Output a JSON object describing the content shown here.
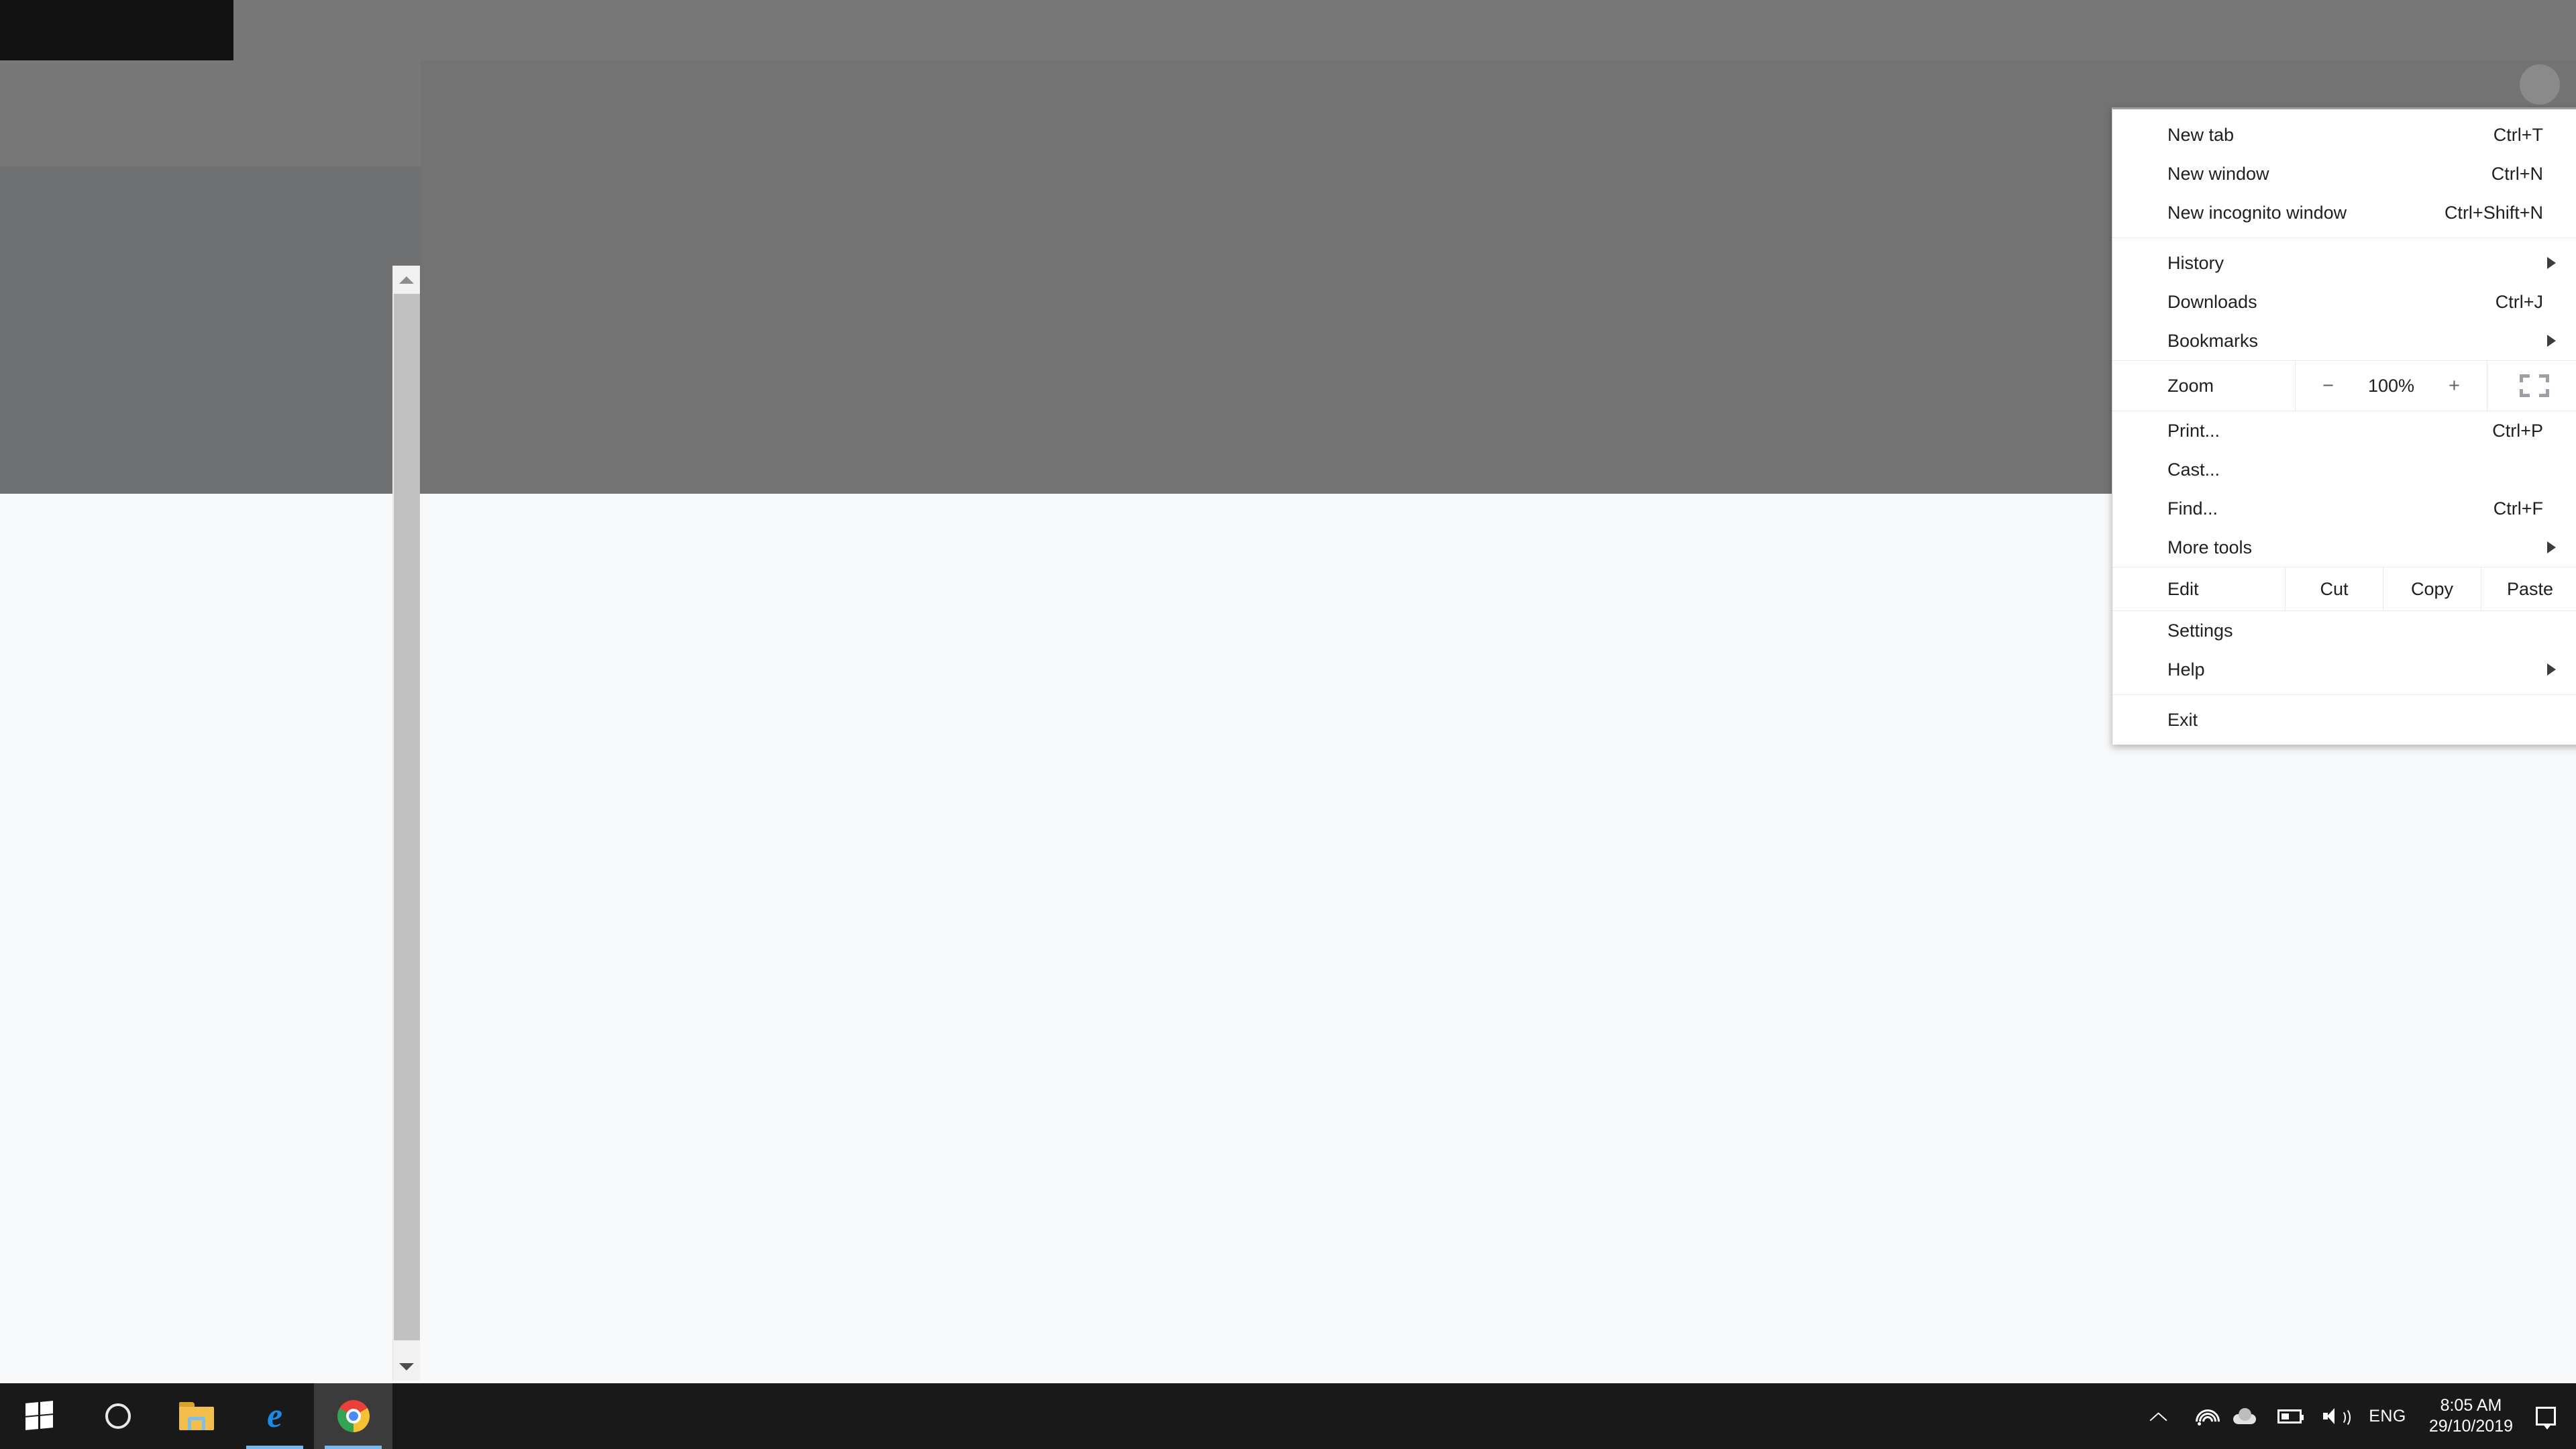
{
  "chrome_menu": {
    "groups": [
      {
        "items": [
          {
            "label": "New tab",
            "shortcut": "Ctrl+T",
            "has_submenu": false
          },
          {
            "label": "New window",
            "shortcut": "Ctrl+N",
            "has_submenu": false
          },
          {
            "label": "New incognito window",
            "shortcut": "Ctrl+Shift+N",
            "has_submenu": false
          }
        ]
      },
      {
        "items": [
          {
            "label": "History",
            "shortcut": "",
            "has_submenu": true
          },
          {
            "label": "Downloads",
            "shortcut": "Ctrl+J",
            "has_submenu": false
          },
          {
            "label": "Bookmarks",
            "shortcut": "",
            "has_submenu": true
          }
        ]
      },
      {
        "items": [
          {
            "label": "Print...",
            "shortcut": "Ctrl+P",
            "has_submenu": false
          },
          {
            "label": "Cast...",
            "shortcut": "",
            "has_submenu": false
          },
          {
            "label": "Find...",
            "shortcut": "Ctrl+F",
            "has_submenu": false
          },
          {
            "label": "More tools",
            "shortcut": "",
            "has_submenu": true
          }
        ]
      },
      {
        "items": [
          {
            "label": "Settings",
            "shortcut": "",
            "has_submenu": false
          },
          {
            "label": "Help",
            "shortcut": "",
            "has_submenu": true
          }
        ]
      },
      {
        "items": [
          {
            "label": "Exit",
            "shortcut": "",
            "has_submenu": false
          }
        ]
      }
    ],
    "zoom_row": {
      "label": "Zoom",
      "decrease_label": "−",
      "value": "100%",
      "increase_label": "+",
      "fullscreen_icon": "fullscreen-icon"
    },
    "edit_row": {
      "label": "Edit",
      "cut_label": "Cut",
      "copy_label": "Copy",
      "paste_label": "Paste"
    }
  },
  "page": {
    "avatar_icon": "avatar-circle",
    "scrollbar": {
      "up_icon": "scroll-up-arrow",
      "down_icon": "scroll-down-arrow"
    }
  },
  "taskbar": {
    "buttons": [
      {
        "name": "start-button",
        "icon": "windows-logo-icon",
        "active": false,
        "running": false
      },
      {
        "name": "cortana-search-button",
        "icon": "cortana-circle-icon",
        "active": false,
        "running": false
      },
      {
        "name": "file-explorer-button",
        "icon": "folder-icon",
        "active": false,
        "running": false
      },
      {
        "name": "microsoft-edge-button",
        "icon": "edge-icon",
        "active": false,
        "running": true
      },
      {
        "name": "google-chrome-button",
        "icon": "chrome-icon",
        "active": true,
        "running": true
      }
    ],
    "tray": {
      "show_hidden_icons": "chevron-up-icon",
      "network_icon": "wifi-icon",
      "onedrive_icon": "cloud-icon",
      "battery_icon": "battery-icon",
      "volume_icon": "speaker-icon",
      "language": "ENG",
      "time": "8:05 AM",
      "date": "29/10/2019",
      "action_center_icon": "notification-icon"
    }
  },
  "colors": {
    "taskbar_bg": "#191919",
    "menu_bg": "#ffffff",
    "page_bg": "#f6f8fa",
    "gray_overlay": "#737373",
    "accent_blue": "#76b9ed"
  }
}
